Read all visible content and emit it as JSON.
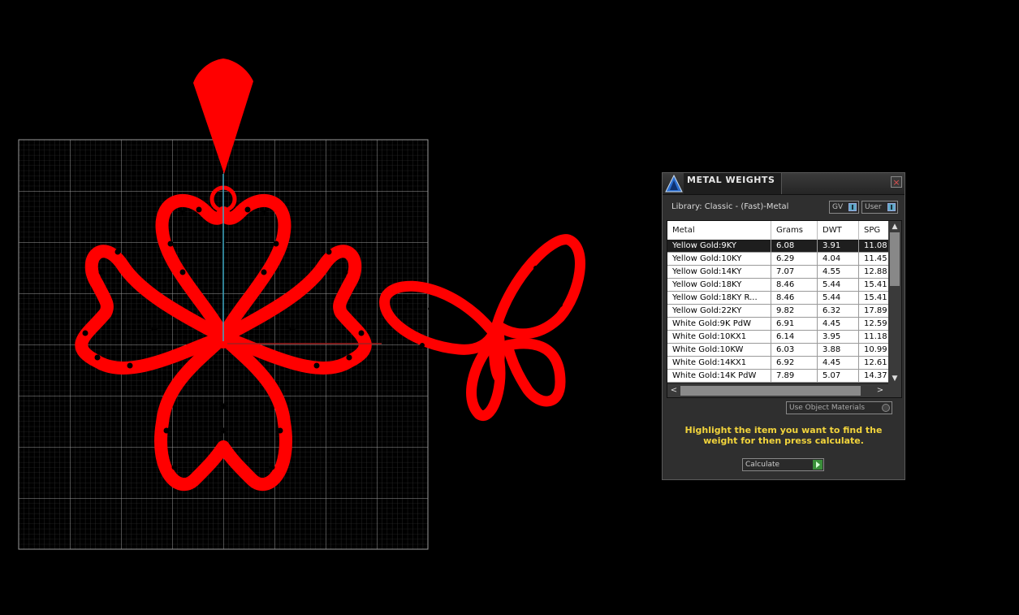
{
  "panel": {
    "title": "METAL WEIGHTS",
    "close_label": "×",
    "library_label": "Library: Classic - (Fast)-Metal",
    "gv_toggle_label": "GV",
    "user_toggle_label": "User",
    "columns": [
      "Metal",
      "Grams",
      "DWT",
      "SPG"
    ],
    "rows": [
      {
        "metal": "Yellow Gold:9KY",
        "grams": "6.08",
        "dwt": "3.91",
        "spg": "11.08"
      },
      {
        "metal": "Yellow Gold:10KY",
        "grams": "6.29",
        "dwt": "4.04",
        "spg": "11.45"
      },
      {
        "metal": "Yellow Gold:14KY",
        "grams": "7.07",
        "dwt": "4.55",
        "spg": "12.88"
      },
      {
        "metal": "Yellow Gold:18KY",
        "grams": "8.46",
        "dwt": "5.44",
        "spg": "15.41"
      },
      {
        "metal": "Yellow Gold:18KY R...",
        "grams": "8.46",
        "dwt": "5.44",
        "spg": "15.41"
      },
      {
        "metal": "Yellow Gold:22KY",
        "grams": "9.82",
        "dwt": "6.32",
        "spg": "17.89"
      },
      {
        "metal": "White Gold:9K PdW",
        "grams": "6.91",
        "dwt": "4.45",
        "spg": "12.59"
      },
      {
        "metal": "White Gold:10KX1",
        "grams": "6.14",
        "dwt": "3.95",
        "spg": "11.18"
      },
      {
        "metal": "White Gold:10KW",
        "grams": "6.03",
        "dwt": "3.88",
        "spg": "10.99"
      },
      {
        "metal": "White Gold:14KX1",
        "grams": "6.92",
        "dwt": "4.45",
        "spg": "12.61"
      },
      {
        "metal": "White Gold:14K PdW",
        "grams": "7.89",
        "dwt": "5.07",
        "spg": "14.37"
      }
    ],
    "selected_row": 0,
    "use_object_materials_label": "Use Object Materials",
    "instruction": "Highlight the item you want to find the weight for then press calculate.",
    "calculate_label": "Calculate",
    "scroll_up_glyph": "▲",
    "scroll_down_glyph": "▼",
    "scroll_left_glyph": "<",
    "scroll_right_glyph": ">"
  },
  "colors": {
    "background": "#000000",
    "model": "#ff0000",
    "grid": "#8a8a8a",
    "axis": "#3fa9c4",
    "instruction_text": "#f2d43c"
  },
  "icons": {
    "app_logo": "app-logo-icon",
    "close": "close-icon",
    "calculate": "play-arrow-icon"
  }
}
